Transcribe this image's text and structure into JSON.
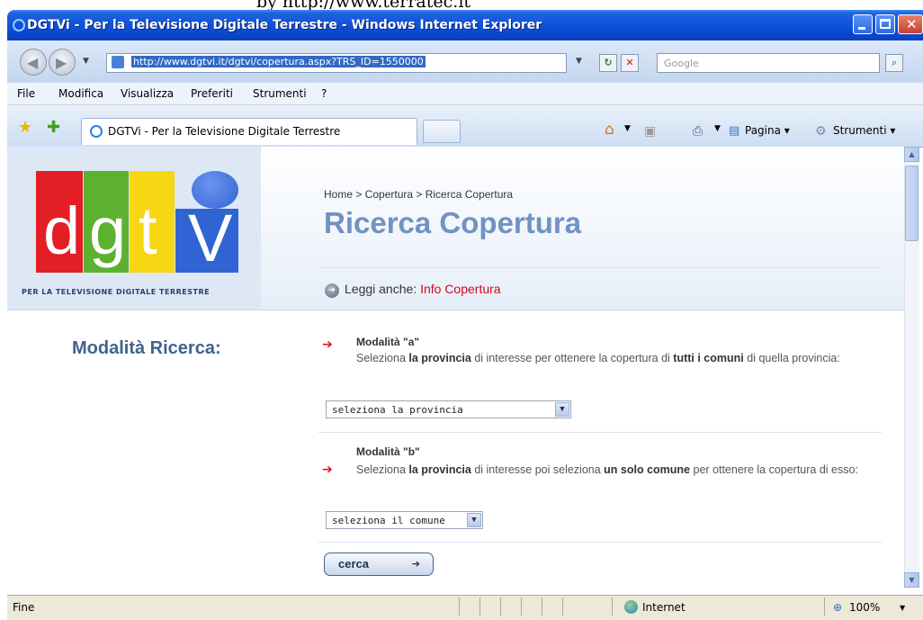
{
  "watermark": "by  http://www.terratec.it",
  "window": {
    "title": "DGTVi - Per la Televisione Digitale Terrestre - Windows Internet Explorer"
  },
  "address_bar": {
    "url": "http://www.dgtvi.it/dgtvi/copertura.aspx?TRS_ID=1550000",
    "search_placeholder": "Google"
  },
  "menu": [
    "File",
    "Modifica",
    "Visualizza",
    "Preferiti",
    "Strumenti",
    "?"
  ],
  "tab": {
    "label": "DGTVi - Per la Televisione Digitale Terrestre"
  },
  "commands": {
    "page": "Pagina",
    "tools": "Strumenti"
  },
  "site": {
    "logo_letters": [
      "d",
      "g",
      "t",
      "V"
    ],
    "logo_colors": [
      "#e31e24",
      "#5db130",
      "#f7d614",
      "#2f64d2"
    ],
    "logo_tagline": "PER LA TELEVISIONE DIGITALE TERRESTRE",
    "breadcrumb": "Home > Copertura > Ricerca Copertura",
    "page_title": "Ricerca Copertura",
    "leggi_anche_prefix": "Leggi anche:",
    "leggi_anche_link": "Info Copertura"
  },
  "search": {
    "heading": "Modalità Ricerca:",
    "mode_a": {
      "title": "Modalità \"a\"",
      "desc_1": "Seleziona ",
      "desc_bold_1": "la provincia",
      "desc_2": " di interesse per ottenere la copertura di ",
      "desc_bold_2": "tutti i comuni",
      "desc_3": " di quella provincia:",
      "select_value": "seleziona la provincia"
    },
    "mode_b": {
      "title": "Modalità \"b\"",
      "desc_1": "Seleziona ",
      "desc_bold_1": "la provincia",
      "desc_2": " di interesse poi seleziona ",
      "desc_bold_2": "un solo comune",
      "desc_3": " per ottenere la copertura di esso:",
      "select_value": "seleziona il comune"
    },
    "button_label": "cerca"
  },
  "status": {
    "text": "Fine",
    "zone": "Internet",
    "zoom": "100%"
  }
}
